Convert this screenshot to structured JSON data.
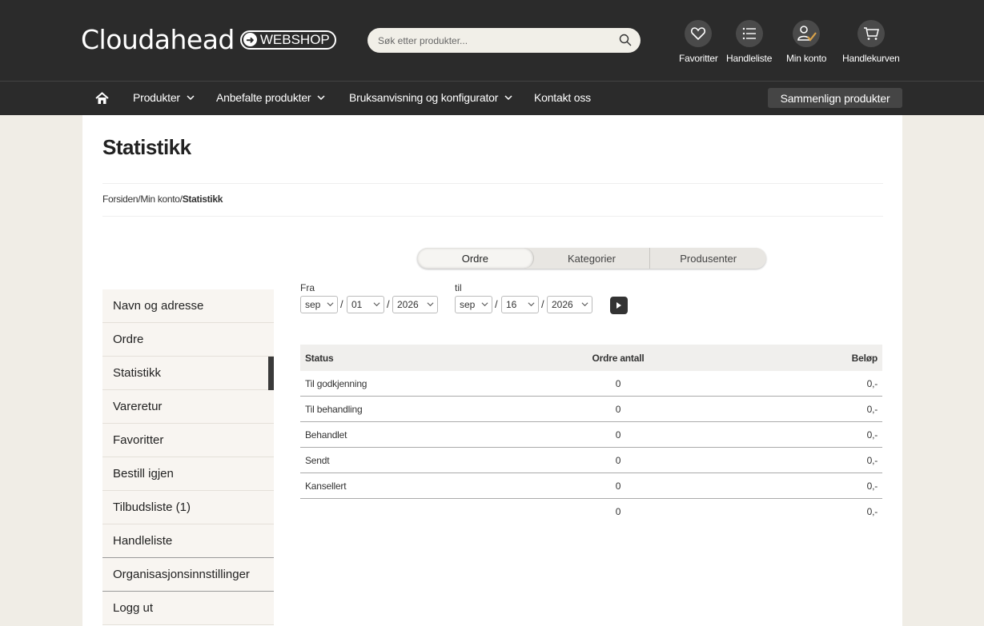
{
  "header": {
    "logo_text": "Cloudahead",
    "logo_badge": "WEBSHOP",
    "search_placeholder": "Søk etter produkter...",
    "icons": [
      {
        "name": "heart-icon",
        "label": "Favoritter"
      },
      {
        "name": "list-icon",
        "label": "Handleliste"
      },
      {
        "name": "user-icon",
        "label": "Min konto"
      },
      {
        "name": "cart-icon",
        "label": "Handlekurven"
      }
    ]
  },
  "nav": {
    "home_icon": "home-icon",
    "items": [
      {
        "label": "Produkter",
        "dropdown": true
      },
      {
        "label": "Anbefalte produkter",
        "dropdown": true
      },
      {
        "label": "Bruksanvisning og konfigurator",
        "dropdown": true
      },
      {
        "label": "Kontakt oss",
        "dropdown": false
      }
    ],
    "compare_label": "Sammenlign produkter"
  },
  "page": {
    "title": "Statistikk",
    "breadcrumb": {
      "home": "Forsiden",
      "sep": "/",
      "account": "Min konto",
      "current": "Statistikk"
    }
  },
  "sidebar": {
    "items": [
      {
        "label": "Navn og adresse"
      },
      {
        "label": "Ordre"
      },
      {
        "label": "Statistikk",
        "active": true
      },
      {
        "label": "Vareretur"
      },
      {
        "label": "Favoritter"
      },
      {
        "label": "Bestill igjen"
      },
      {
        "label": "Tilbudsliste (1)"
      },
      {
        "label": "Handleliste"
      },
      {
        "label": "Organisasjonsinnstillinger"
      },
      {
        "label": "Logg ut"
      }
    ]
  },
  "tabs": [
    {
      "label": "Ordre",
      "active": true
    },
    {
      "label": "Kategorier"
    },
    {
      "label": "Produsenter"
    }
  ],
  "filters": {
    "from_label": "Fra",
    "to_label": "til",
    "from": {
      "month": "sep",
      "day": "01",
      "year": "2026"
    },
    "to": {
      "month": "sep",
      "day": "16",
      "year": "2026"
    },
    "separator": "/"
  },
  "table": {
    "headers": [
      "Status",
      "Ordre antall",
      "Beløp"
    ],
    "rows": [
      [
        "Til godkjenning",
        "0",
        "0,-"
      ],
      [
        "Til behandling",
        "0",
        "0,-"
      ],
      [
        "Behandlet",
        "0",
        "0,-"
      ],
      [
        "Sendt",
        "0",
        "0,-"
      ],
      [
        "Kansellert",
        "0",
        "0,-"
      ]
    ],
    "total": [
      "",
      "0",
      "0,-"
    ]
  }
}
